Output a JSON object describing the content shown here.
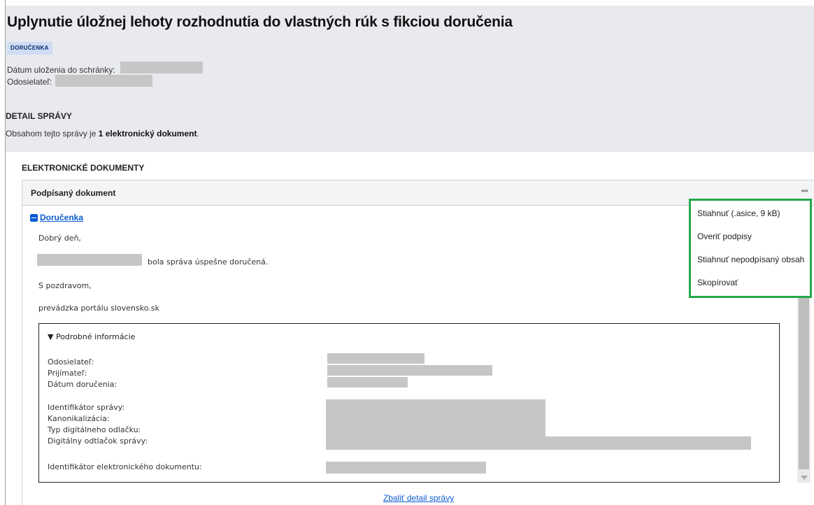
{
  "header": {
    "title": "Uplynutie úložnej lehoty rozhodnutia do vlastných rúk s fikciou doručenia",
    "badge": "DORUČENKA",
    "date_label": "Dátum uloženia do schránky:",
    "sender_label": "Odosielateľ:",
    "detail_title": "DETAIL SPRÁVY",
    "summary_prefix": "Obsahom tejto správy je ",
    "summary_bold": "1 elektronický dokument",
    "summary_suffix": "."
  },
  "documents": {
    "section_title": "ELEKTRONICKÉ DOKUMENTY",
    "panel_title": "Podpísaný dokument",
    "more_icon": "ellipsis-icon",
    "document_name": " Doručenka",
    "greeting": "Dobrý deň,",
    "delivered_text": "bola správa úspešne doručená.",
    "closing": "S pozdravom,",
    "signature": "prevádzka portálu slovensko.sk"
  },
  "details": {
    "summary": "▼ Podrobné informácie",
    "labels": {
      "sender": "Odosielateľ:",
      "recipient": "Prijímateľ:",
      "delivery_date": "Dátum doručenia:",
      "message_id": "Identifikátor správy:",
      "canonicalization": "Kanonikalizácia:",
      "digest_type": "Typ digitálneho odlačku:",
      "digest": "Digitálny odtlačok správy:",
      "document_id": "Identifikátor elektronického dokumentu:"
    }
  },
  "footer": {
    "collapse_link": "Zbaliť detail správy"
  },
  "menu": {
    "items": [
      "Stiahnuť (.asice, 9 kB)",
      "Overiť podpisy",
      "Stiahnuť nepodpísaný obsah",
      "Skopírovať"
    ],
    "highlight_color": "#22a94a"
  },
  "colors": {
    "link": "#0b5bd3",
    "header_bg": "#e8eaee",
    "badge_bg": "#cfdcf3",
    "redaction": "#c6c6c6"
  }
}
